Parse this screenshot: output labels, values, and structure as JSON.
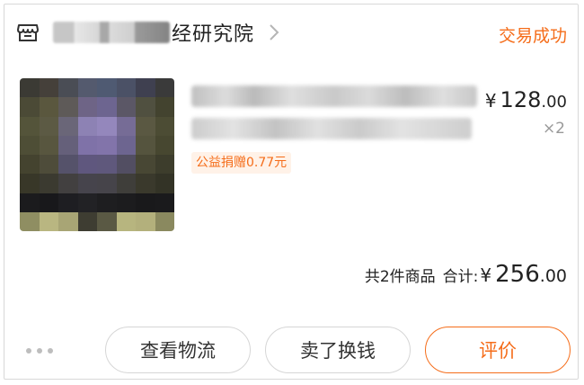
{
  "shop": {
    "icon": "store-icon",
    "name_visible": "经研究院",
    "status": "交易成功"
  },
  "item": {
    "charity_tag": "公益捐赠0.77元",
    "price": {
      "currency": "¥",
      "integer": "128",
      "decimal": ".00"
    },
    "quantity": "×2"
  },
  "totals": {
    "count_text": "共2件商品",
    "label": "合计:",
    "currency": "¥",
    "integer": "256",
    "decimal": ".00"
  },
  "actions": {
    "logistics": "查看物流",
    "resell": "卖了换钱",
    "review": "评价"
  },
  "colors": {
    "accent": "#f56d1a",
    "charity_bg": "#fff2e8",
    "muted": "#999999"
  }
}
